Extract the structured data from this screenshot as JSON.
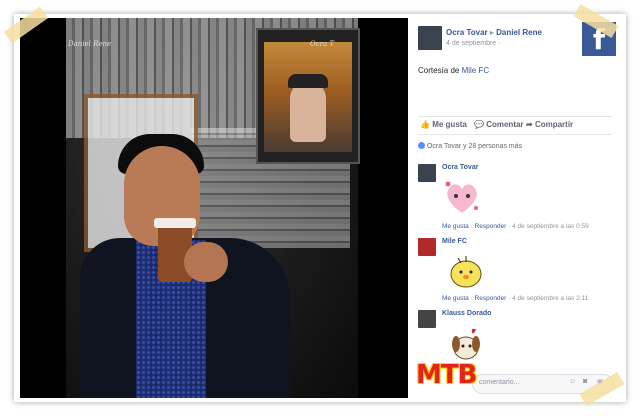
{
  "photo": {
    "watermark_left": "Daniel Rene",
    "watermark_right": "Ocra T"
  },
  "overlay": {
    "mtb_label": "MTB"
  },
  "post": {
    "author": "Ocra Tovar",
    "arrow": "▸",
    "target": "Daniel Rene",
    "date": "4 de septiembre",
    "date_suffix": "·",
    "desc_prefix": "Cortesía de ",
    "desc_link": "Mile FC",
    "brand_glyph": "f",
    "brand_color": "#3b5998"
  },
  "actions": {
    "like": "Me gusta",
    "comment": "Comentar",
    "share": "Compartir"
  },
  "reactions": {
    "text": "Ocra Tovar y 28 personas más"
  },
  "comments": [
    {
      "name": "Ocra Tovar",
      "meta_like": "Me gusta",
      "meta_reply": "Responder",
      "meta_time": "4 de septiembre a las 0:59"
    },
    {
      "name": "Mile FC",
      "meta_like": "Me gusta",
      "meta_reply": "Responder",
      "meta_time": "4 de septiembre a las 2:11"
    },
    {
      "name": "Klauss Dorado"
    }
  ],
  "composer": {
    "placeholder": "comentario..."
  },
  "icons": [
    "like-icon",
    "comment-icon",
    "share-icon",
    "emoji-icon",
    "camera-icon",
    "gif-icon",
    "facebook-logo-icon"
  ]
}
